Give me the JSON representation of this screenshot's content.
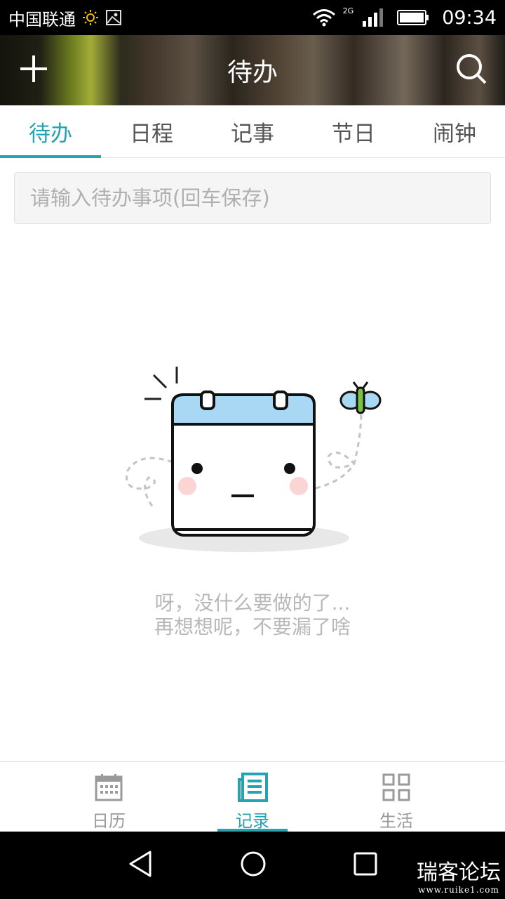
{
  "status_bar": {
    "carrier": "中国联通",
    "network_type": "2G",
    "time": "09:34",
    "icons": [
      "brightness-icon",
      "image-icon",
      "wifi-icon",
      "signal-icon",
      "battery-icon"
    ]
  },
  "header": {
    "title": "待办",
    "left_icon": "plus-icon",
    "right_icon": "search-icon"
  },
  "tabs": [
    {
      "label": "待办",
      "active": true
    },
    {
      "label": "日程",
      "active": false
    },
    {
      "label": "记事",
      "active": false
    },
    {
      "label": "节日",
      "active": false
    },
    {
      "label": "闹钟",
      "active": false
    }
  ],
  "todo_input": {
    "placeholder": "请输入待办事项(回车保存)",
    "value": ""
  },
  "empty_state": {
    "line1": "呀，没什么要做的了...",
    "line2": "再想想呢，不要漏了啥"
  },
  "bottom_nav": [
    {
      "label": "日历",
      "icon": "calendar-icon",
      "active": false
    },
    {
      "label": "记录",
      "icon": "notes-icon",
      "active": true
    },
    {
      "label": "生活",
      "icon": "grid-icon",
      "active": false
    }
  ],
  "system_nav": [
    "back-icon",
    "home-icon",
    "recents-icon"
  ],
  "watermark": {
    "text": "瑞客论坛",
    "url": "www.ruike1.com"
  },
  "colors": {
    "accent": "#26a3b0",
    "inactive_text": "#555555",
    "placeholder": "#b0b0b0"
  }
}
